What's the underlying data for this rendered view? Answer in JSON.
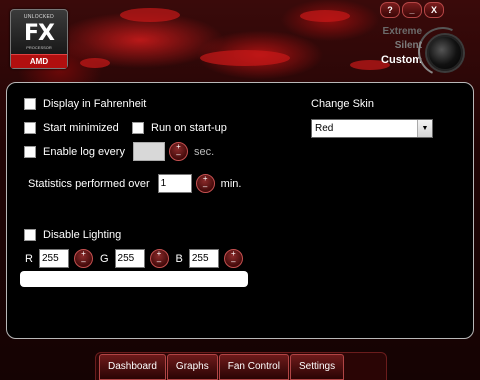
{
  "logo": {
    "unlocked": "UNLOCKED",
    "brand": "FX",
    "processor": "PROCESSOR",
    "maker": "AMD"
  },
  "window_controls": [
    "?",
    "_",
    "X"
  ],
  "modes": [
    "Extreme",
    "Silent",
    "Custom"
  ],
  "settings": {
    "display_fahrenheit": "Display in Fahrenheit",
    "start_minimized": "Start minimized",
    "run_on_startup": "Run on start-up",
    "enable_log": "Enable log every",
    "log_unit": "sec.",
    "statistics_label": "Statistics performed over",
    "statistics_value": "1",
    "statistics_unit": "min.",
    "disable_lighting": "Disable Lighting",
    "rgb": {
      "r_label": "R",
      "r_value": "255",
      "g_label": "G",
      "g_value": "255",
      "b_label": "B",
      "b_value": "255"
    },
    "change_skin_label": "Change Skin",
    "skin_value": "Red"
  },
  "spinner": {
    "plus": "+",
    "minus": "–"
  },
  "tabs": [
    "Dashboard",
    "Graphs",
    "Fan Control",
    "Settings"
  ],
  "colors": {
    "accent": "#c81818",
    "panel_bg": "#000000",
    "panel_border": "#b8b8b8"
  }
}
